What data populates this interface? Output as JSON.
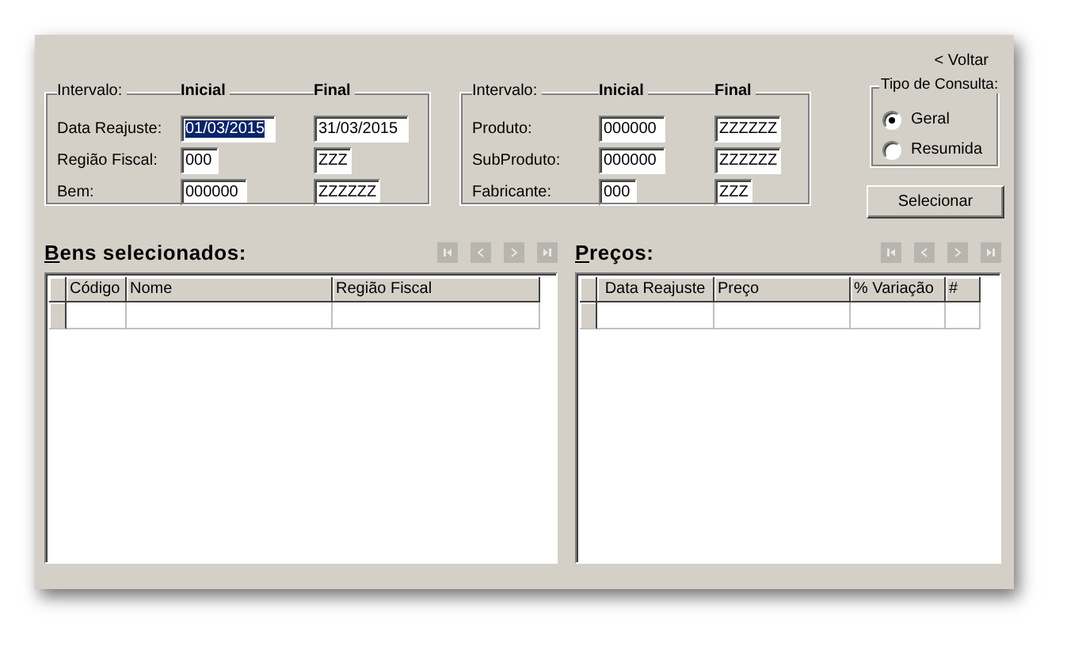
{
  "back_link": {
    "label": "< Voltar"
  },
  "filter_groups": [
    {
      "headers": [
        "Intervalo:",
        "Inicial",
        "Final"
      ],
      "rows": [
        {
          "label": "Data Reajuste:",
          "from": {
            "value": "01/03/2015",
            "selected": true
          },
          "to": {
            "value": "31/03/2015",
            "selected": false
          }
        },
        {
          "label": "Região Fiscal:",
          "from": {
            "value": "000",
            "selected": false
          },
          "to": {
            "value": "ZZZ",
            "selected": false
          }
        },
        {
          "label": "Bem:",
          "from": {
            "value": "000000",
            "selected": false
          },
          "to": {
            "value": "ZZZZZZ",
            "selected": false
          }
        }
      ]
    },
    {
      "headers": [
        "Intervalo:",
        "Inicial",
        "Final"
      ],
      "rows": [
        {
          "label": "Produto:",
          "from": {
            "value": "000000",
            "selected": false
          },
          "to": {
            "value": "ZZZZZZ",
            "selected": false
          }
        },
        {
          "label": "SubProduto:",
          "from": {
            "value": "000000",
            "selected": false
          },
          "to": {
            "value": "ZZZZZZ",
            "selected": false
          }
        },
        {
          "label": "Fabricante:",
          "from": {
            "value": "000",
            "selected": false
          },
          "to": {
            "value": "ZZZ",
            "selected": false
          }
        }
      ]
    }
  ],
  "query_type": {
    "title": "Tipo de Consulta:",
    "options": [
      {
        "label": "Geral",
        "selected": true
      },
      {
        "label": "Resumida",
        "selected": false
      }
    ]
  },
  "select_button": "Selecionar",
  "grids": [
    {
      "title": "Bens selecionados:",
      "nav": [
        {
          "kind": "first",
          "disabled": true
        },
        {
          "kind": "prev",
          "disabled": true
        },
        {
          "kind": "next",
          "disabled": true
        },
        {
          "kind": "last",
          "disabled": true
        }
      ],
      "columns": [
        "Código",
        "Nome",
        "Região Fiscal"
      ]
    },
    {
      "title": "Preços:",
      "nav": [
        {
          "kind": "first",
          "disabled": true
        },
        {
          "kind": "prev",
          "disabled": true
        },
        {
          "kind": "next",
          "disabled": true
        },
        {
          "kind": "last",
          "disabled": true
        }
      ],
      "columns": [
        "Data Reajuste",
        "Preço",
        "% Variação",
        "#"
      ]
    }
  ]
}
